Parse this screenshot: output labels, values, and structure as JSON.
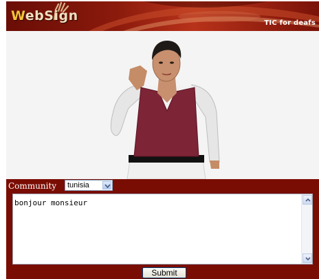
{
  "header": {
    "logo_text_w": "W",
    "logo_text_rest": "ebSign",
    "tagline": "TIC for deafs"
  },
  "viewport": {
    "avatar": "signing-avatar-image"
  },
  "community": {
    "label": "Community",
    "selected": "tunisia"
  },
  "input": {
    "value": "bonjour monsieur"
  },
  "actions": {
    "submit_label": "Submit"
  },
  "colors": {
    "bar": "#7a0d03",
    "banner": "#8a1a0c",
    "viewport_bg": "#f4f4f4"
  }
}
